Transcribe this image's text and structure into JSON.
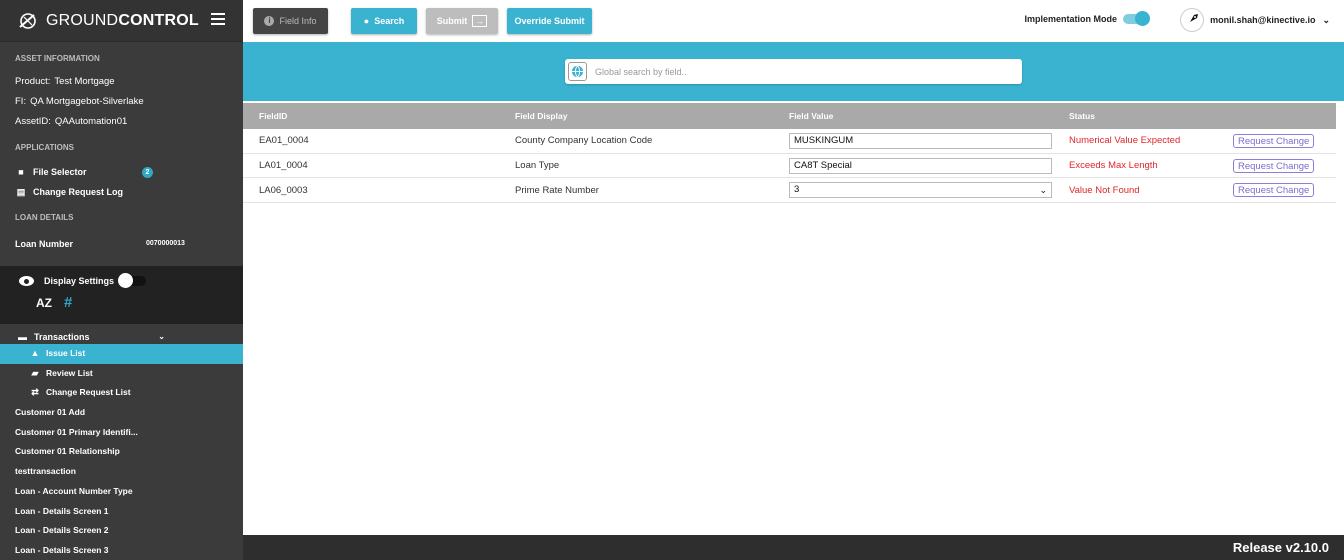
{
  "brand": {
    "part1": "GROUND",
    "part2": "CONTROL"
  },
  "sidebar": {
    "asset_header": "ASSET INFORMATION",
    "product_label": "Product:",
    "product_value": "Test Mortgage",
    "fi_label": "FI:",
    "fi_value": "QA Mortgagebot-Silverlake",
    "asset_label": "AssetID:",
    "asset_value": "QAAutomation01",
    "apps_header": "APPLICATIONS",
    "file_selector": "File Selector",
    "file_selector_badge": "2",
    "change_request_log": "Change Request Log",
    "loan_header": "LOAN DETAILS",
    "loan_number_label": "Loan Number",
    "loan_number_value": "0070000013",
    "display_settings": "Display Settings",
    "sort_az": "AZ",
    "sort_hash": "#",
    "transactions": "Transactions",
    "issue_list": "Issue List",
    "review_list": "Review List",
    "change_request_list": "Change Request List",
    "items": [
      "Customer 01 Add",
      "Customer 01 Primary Identifi...",
      "Customer 01 Relationship",
      "testtransaction",
      "Loan - Account Number Type",
      "Loan - Details Screen 1",
      "Loan - Details Screen 2",
      "Loan - Details Screen 3"
    ]
  },
  "toolbar": {
    "field_info": "Field Info",
    "search": "Search",
    "submit": "Submit",
    "override_submit": "Override Submit",
    "implementation_mode": "Implementation Mode",
    "user": "monil.shah@kinective.io"
  },
  "search": {
    "placeholder": "Global search by field.."
  },
  "table": {
    "headers": [
      "FieldID",
      "Field Display",
      "Field Value",
      "Status"
    ],
    "rows": [
      {
        "id": "EA01_0004",
        "display": "County Company Location Code",
        "value": "MUSKINGUM",
        "status": "Numerical Value Expected",
        "action": "Request Change"
      },
      {
        "id": "LA01_0004",
        "display": "Loan Type",
        "value": "CA8T Special",
        "status": "Exceeds Max Length",
        "action": "Request Change"
      },
      {
        "id": "LA06_0003",
        "display": "Prime Rate Number",
        "value": "3",
        "status": "Value Not Found",
        "action": "Request Change"
      }
    ]
  },
  "footer": {
    "release": "Release v2.10.0"
  },
  "colors": {
    "accent": "#3ab3d1",
    "status_error": "#e0262b",
    "sidebar": "#3b3b3b"
  }
}
